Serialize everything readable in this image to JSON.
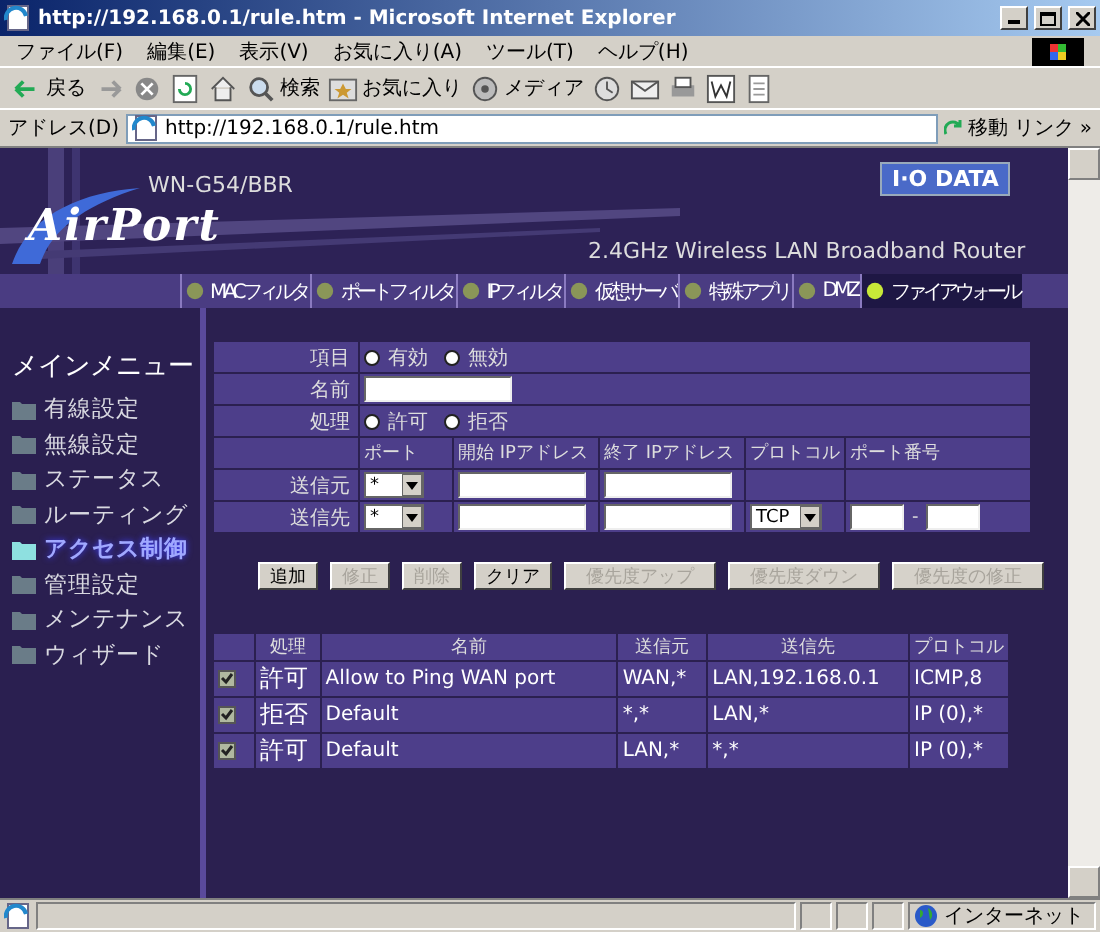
{
  "window": {
    "title": "http://192.168.0.1/rule.htm - Microsoft Internet Explorer"
  },
  "menu": [
    "ファイル(F)",
    "編集(E)",
    "表示(V)",
    "お気に入り(A)",
    "ツール(T)",
    "ヘルプ(H)"
  ],
  "toolbar": [
    {
      "kind": "back",
      "label": "戻る"
    },
    {
      "kind": "forward"
    },
    {
      "kind": "stop"
    },
    {
      "kind": "refresh"
    },
    {
      "kind": "home"
    },
    {
      "kind": "search",
      "label": "検索"
    },
    {
      "kind": "favorites",
      "label": "お気に入り"
    },
    {
      "kind": "media",
      "label": "メディア"
    },
    {
      "kind": "history"
    },
    {
      "kind": "mail"
    },
    {
      "kind": "print"
    },
    {
      "kind": "edit"
    },
    {
      "kind": "discuss"
    }
  ],
  "address": {
    "label": "アドレス(D)",
    "value": "http://192.168.0.1/rule.htm",
    "go": "移動",
    "links": "リンク",
    "more": "»"
  },
  "header": {
    "model": "WN-G54/BBR",
    "logo": "AirPort",
    "brand": "I·O DATA",
    "tagline": "2.4GHz Wireless LAN Broadband Router"
  },
  "tabs": [
    {
      "label": "MACフィルタ",
      "selected": false
    },
    {
      "label": "ポートフィルタ",
      "selected": false
    },
    {
      "label": "IPフィルタ",
      "selected": false
    },
    {
      "label": "仮想サーバ",
      "selected": false
    },
    {
      "label": "特殊アプリ",
      "selected": false
    },
    {
      "label": "DMZ",
      "selected": false
    },
    {
      "label": "ファイアウォール",
      "selected": true
    }
  ],
  "sidebar": {
    "title": "メインメニュー",
    "items": [
      {
        "label": "有線設定",
        "selected": false
      },
      {
        "label": "無線設定",
        "selected": false
      },
      {
        "label": "ステータス",
        "selected": false
      },
      {
        "label": "ルーティング",
        "selected": false
      },
      {
        "label": "アクセス制御",
        "selected": true
      },
      {
        "label": "管理設定",
        "selected": false
      },
      {
        "label": "メンテナンス",
        "selected": false
      },
      {
        "label": "ウィザード",
        "selected": false
      }
    ]
  },
  "form": {
    "item": {
      "label": "項目",
      "options": [
        {
          "label": "有効",
          "selected": false
        },
        {
          "label": "無効",
          "selected": false
        }
      ]
    },
    "name": {
      "label": "名前"
    },
    "action": {
      "label": "処理",
      "options": [
        {
          "label": "許可",
          "selected": false
        },
        {
          "label": "拒否",
          "selected": false
        }
      ]
    },
    "columns": [
      "ポート",
      "開始 IPアドレス",
      "終了 IPアドレス",
      "プロトコル",
      "ポート番号"
    ],
    "source": {
      "label": "送信元",
      "port": "*"
    },
    "destination": {
      "label": "送信先",
      "port": "*",
      "protocol": "TCP",
      "port_separator": "-"
    }
  },
  "buttons": [
    {
      "label": "追加",
      "disabled": false
    },
    {
      "label": "修正",
      "disabled": true
    },
    {
      "label": "削除",
      "disabled": true
    },
    {
      "label": "クリア",
      "disabled": false
    },
    {
      "label": "優先度アップ",
      "disabled": true
    },
    {
      "label": "優先度ダウン",
      "disabled": true
    },
    {
      "label": "優先度の修正",
      "disabled": true
    }
  ],
  "rules": {
    "columns": [
      "処理",
      "名前",
      "送信元",
      "送信先",
      "プロトコル"
    ],
    "rows": [
      {
        "checked": true,
        "action": "許可",
        "name": "Allow to Ping WAN port",
        "source": "WAN,*",
        "destination": "LAN,192.168.0.1",
        "protocol": "ICMP,8"
      },
      {
        "checked": true,
        "action": "拒否",
        "name": "Default",
        "source": "*,*",
        "destination": "LAN,*",
        "protocol": "IP (0),*"
      },
      {
        "checked": true,
        "action": "許可",
        "name": "Default",
        "source": "LAN,*",
        "destination": "*,*",
        "protocol": "IP (0),*"
      }
    ]
  },
  "status_bar": {
    "zone": "インターネット"
  }
}
